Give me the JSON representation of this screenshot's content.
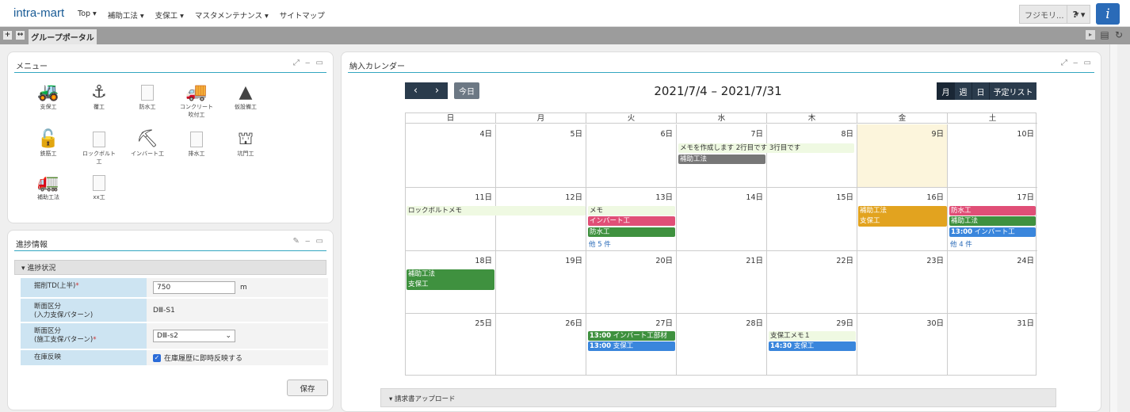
{
  "header": {
    "brand": "intra-mart",
    "nav": [
      "Top ▾",
      "補助工法 ▾",
      "支保工 ▾",
      "マスタメンテナンス ▾",
      "サイトマップ"
    ],
    "user": "フジモリ...",
    "user_caret": "▾",
    "help": "? ▾",
    "info_icon": "i"
  },
  "tabbar": {
    "add": "+",
    "collapse": "↔",
    "tab_label": "グループポータル"
  },
  "menu_portlet": {
    "title": "メニュー",
    "controls": "⤢ ‒ ▭",
    "items": [
      {
        "label": "支保工",
        "icon": "excavator-icon"
      },
      {
        "label": "覆工",
        "icon": "crane-hook-icon"
      },
      {
        "label": "防水工",
        "icon": "document-icon"
      },
      {
        "label": "コンクリート\n吹付工",
        "icon": "mixer-truck-icon"
      },
      {
        "label": "仮設備工",
        "icon": "drill-tower-icon"
      },
      {
        "label": "鉄筋工",
        "icon": "rebar-icon"
      },
      {
        "label": "ロックボルト\n工",
        "icon": "document-icon"
      },
      {
        "label": "インバート工",
        "icon": "pickaxe-icon"
      },
      {
        "label": "排水工",
        "icon": "document-icon"
      },
      {
        "label": "坑門工",
        "icon": "tunnel-icon"
      },
      {
        "label": "補助工法",
        "icon": "dump-truck-icon"
      },
      {
        "label": "xx工",
        "icon": "document-icon"
      }
    ]
  },
  "progress_portlet": {
    "title": "進捗情報",
    "controls": "✎ ‒ ▭",
    "section": "▾  進捗状況",
    "fields": {
      "depth_label": "掘削TD(上半)",
      "depth_value": "750",
      "depth_unit": "m",
      "input_pattern_label": "断面区分\n(入力支保パターン)",
      "input_pattern_value": "DⅢ-S1",
      "actual_pattern_label": "断面区分\n(施工支保パターン)",
      "actual_pattern_value": "DⅢ-s2",
      "stock_label": "在庫反映",
      "stock_check": "在庫履歴に即時反映する",
      "required_mark": "*"
    },
    "save_label": "保存"
  },
  "calendar_portlet": {
    "title": "納入カレンダー",
    "controls": "⤢ ‒ ▭",
    "prev": "‹",
    "next": "›",
    "today": "今日",
    "range": "2021/7/4 – 2021/7/31",
    "views": [
      "月",
      "週",
      "日",
      "予定リスト"
    ],
    "weekdays": [
      "日",
      "月",
      "火",
      "水",
      "木",
      "金",
      "土"
    ],
    "weeks": [
      [
        "4日",
        "5日",
        "6日",
        "7日",
        "8日",
        "9日",
        "10日"
      ],
      [
        "11日",
        "12日",
        "13日",
        "14日",
        "15日",
        "16日",
        "17日"
      ],
      [
        "18日",
        "19日",
        "20日",
        "21日",
        "22日",
        "23日",
        "24日"
      ],
      [
        "25日",
        "26日",
        "27日",
        "28日",
        "29日",
        "30日",
        "31日"
      ]
    ],
    "events": {
      "w1_memo": "メモを作成します 2行目です 3行目です",
      "w1_gray": "補助工法",
      "w2_rockbolt": "ロックボルトメモ",
      "w2_memo": "メモ",
      "w2_invert": "インバート工",
      "w2_bousui": "防水工",
      "w2_more_tue": "他 5 件",
      "w2_orange1": "補助工法",
      "w2_orange2": "支保工",
      "w2_sat_pink": "防水工",
      "w2_sat_green": "補助工法",
      "w2_sat_blue_time": "13:00",
      "w2_sat_blue_text": "インバート工",
      "w2_more_sat": "他 4 件",
      "w3_green1": "補助工法",
      "w3_green2": "支保工",
      "w4_tue_green_time": "13:00",
      "w4_tue_green_text": "インバート工部材",
      "w4_tue_blue_time": "13:00",
      "w4_tue_blue_text": "支保工",
      "w4_thu_memo": "支保工メモ１",
      "w4_thu_blue_time": "14:30",
      "w4_thu_blue_text": "支保工"
    }
  },
  "upload_section": "▾  請求書アップロード",
  "colors": {
    "accent_line": "#33a6c1",
    "nav_dark": "#2a3b4c",
    "event_green": "#3f913f",
    "event_pink": "#e04f77",
    "event_orange": "#e2a31f",
    "event_blue": "#3a86dc",
    "today_highlight": "#fcf5dc"
  }
}
